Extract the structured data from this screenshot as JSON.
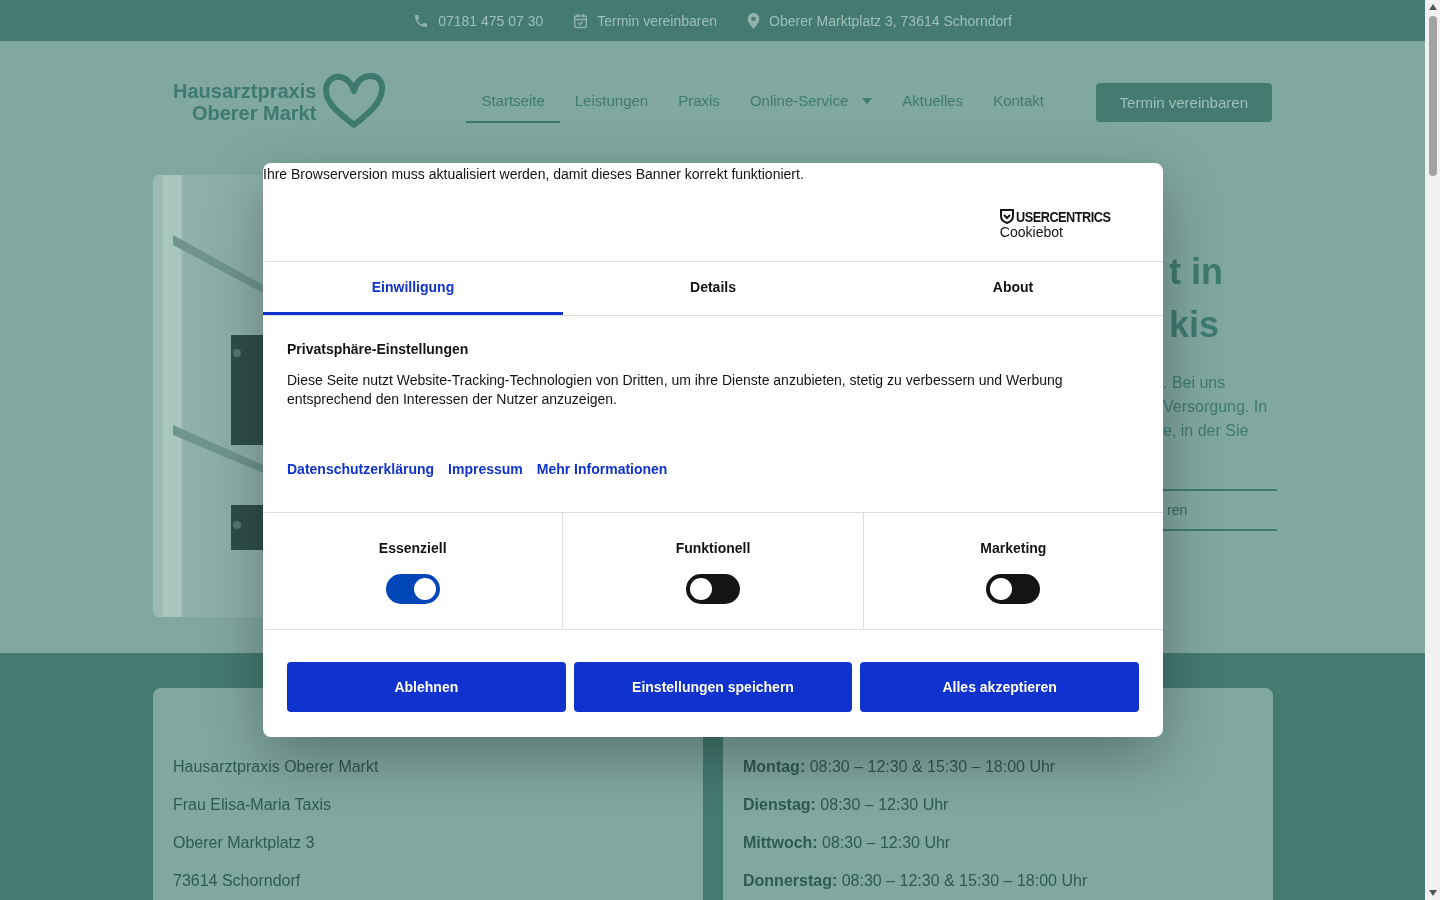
{
  "top_bar": {
    "items": [
      {
        "kind": "phone",
        "text": "07181 475 07 30"
      },
      {
        "kind": "calendar",
        "text": "Termin vereinbaren"
      },
      {
        "kind": "pin",
        "text": "Oberer Marktplatz 3, 73614 Schorndorf"
      }
    ]
  },
  "header": {
    "logo": {
      "line1": "Hausarztpraxis",
      "line2": "Oberer Markt"
    },
    "nav": [
      {
        "label": "Startseite",
        "selected": true,
        "dropdown": false
      },
      {
        "label": "Leistungen",
        "selected": false,
        "dropdown": false
      },
      {
        "label": "Praxis",
        "selected": false,
        "dropdown": false
      },
      {
        "label": "Online-Service",
        "selected": false,
        "dropdown": true
      },
      {
        "label": "Aktuelles",
        "selected": false,
        "dropdown": false
      },
      {
        "label": "Kontakt",
        "selected": false,
        "dropdown": false
      }
    ],
    "cta": "Termin vereinbaren"
  },
  "hero": {
    "heading_lines": [
      "t in",
      "kis"
    ],
    "paragraph_lines": [
      ". Bei uns",
      "Versorgung. In",
      "e, in der Sie"
    ],
    "button": "ren"
  },
  "cookie_banner": {
    "notice": "Ihre Browserversion muss aktualisiert werden, damit dieses Banner korrekt funktioniert.",
    "brand": {
      "name": "USERCENTRICS",
      "product": "Cookiebot"
    },
    "tabs": [
      {
        "label": "Einwilligung",
        "selected": true
      },
      {
        "label": "Details",
        "selected": false
      },
      {
        "label": "About",
        "selected": false
      }
    ],
    "title": "Privatsphäre-Einstellungen",
    "text": "Diese Seite nutzt Website-Tracking-Technologien von Dritten, um ihre Dienste anzubieten, stetig zu verbessern und Werbung entsprechend den Interessen der Nutzer anzuzeigen.",
    "links": [
      "Datenschutzerklärung",
      "Impressum",
      "Mehr Informationen"
    ],
    "categories": [
      {
        "label": "Essenziell",
        "checked": true
      },
      {
        "label": "Funktionell",
        "checked": false
      },
      {
        "label": "Marketing",
        "checked": false
      }
    ],
    "buttons": [
      "Ablehnen",
      "Einstellungen speichern",
      "Alles akzeptieren"
    ]
  },
  "info": {
    "address_lines": [
      "Hausarztpraxis Oberer Markt",
      "Frau Elisa-Maria Taxis",
      "Oberer Marktplatz 3",
      "73614 Schorndorf"
    ],
    "hours": [
      {
        "day": "Montag:",
        "time": "08:30 – 12:30 & 15:30 – 18:00 Uhr"
      },
      {
        "day": "Dienstag:",
        "time": "08:30 – 12:30 Uhr"
      },
      {
        "day": "Mittwoch:",
        "time": "08:30 – 12:30 Uhr"
      },
      {
        "day": "Donnerstag:",
        "time": "08:30 – 12:30 & 15:30 – 18:00 Uhr"
      }
    ]
  }
}
